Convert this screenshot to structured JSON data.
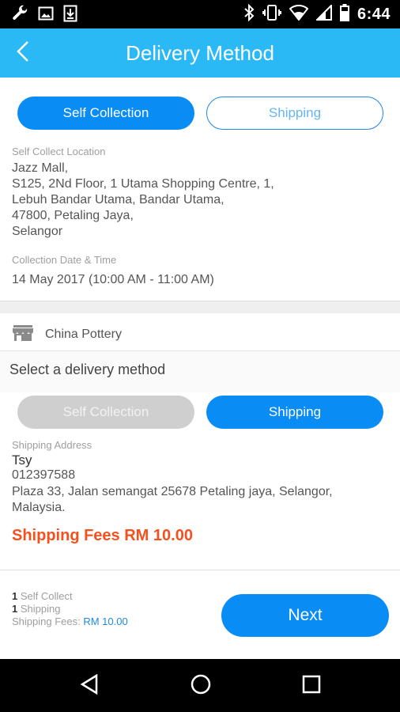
{
  "status_bar": {
    "time": "6:44",
    "icons": [
      "wrench-icon",
      "image-icon",
      "download-icon",
      "bluetooth-icon",
      "vibrate-icon",
      "wifi-icon",
      "signal-icon",
      "battery-icon"
    ]
  },
  "app_bar": {
    "title": "Delivery Method",
    "back_icon": "chevron-left-icon",
    "color": "#2bb9f5"
  },
  "top_section": {
    "toggle": {
      "left_label": "Self Collection",
      "right_label": "Shipping",
      "selected": "Self Collection"
    },
    "location_label": "Self Collect Location",
    "location_lines": [
      "Jazz Mall,",
      "S125, 2Nd Floor, 1 Utama Shopping Centre, 1,",
      "Lebuh Bandar Utama, Bandar Utama,",
      "47800, Petaling Jaya,",
      "Selangor"
    ],
    "datetime_label": "Collection Date & Time",
    "datetime_value": "14 May 2017  (10:00 AM - 11:00 AM)"
  },
  "store": {
    "icon": "store-icon",
    "name": "China Pottery"
  },
  "store_section": {
    "heading": "Select a delivery method",
    "toggle": {
      "left_label": "Self Collection",
      "right_label": "Shipping",
      "selected": "Shipping"
    },
    "shipping_label": "Shipping Address",
    "recipient_name": "Tsy",
    "recipient_phone": "012397588",
    "address_line1": "Plaza 33, Jalan semangat 25678 Petaling jaya, Selangor,",
    "address_line2": "Malaysia.",
    "fees_text": "Shipping Fees RM  10.00"
  },
  "footer": {
    "self_collect_count": "1",
    "self_collect_label": " Self Collect",
    "shipping_count": "1",
    "shipping_label": " Shipping",
    "fees_label": "Shipping Fees: ",
    "fees_value": "RM 10.00",
    "next_label": "Next"
  },
  "nav_bar": {
    "icons": [
      "back-triangle-icon",
      "home-circle-icon",
      "recents-square-icon"
    ]
  },
  "colors": {
    "accent": "#0a8cf5",
    "fees": "#f4511e",
    "disabled": "#cfcfcf"
  }
}
